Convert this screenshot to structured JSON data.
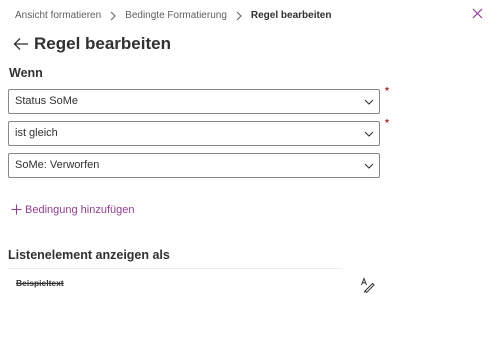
{
  "breadcrumb": {
    "items": [
      "Ansicht formatieren",
      "Bedingte Formatierung"
    ],
    "current": "Regel bearbeiten"
  },
  "header": {
    "title": "Regel bearbeiten"
  },
  "condition": {
    "section_label": "Wenn",
    "field": {
      "value": "Status SoMe",
      "required": true
    },
    "operator": {
      "value": "ist gleich",
      "required": true
    },
    "comparison": {
      "value": "SoMe: Verworfen",
      "required": false
    },
    "required_marker": "*",
    "add_label": "Bedingung hinzufügen"
  },
  "display": {
    "label": "Listenelement anzeigen als",
    "sample_text": "Beispieltext"
  },
  "colors": {
    "accent": "#8f3f8f",
    "required": "#a4262c",
    "border": "#8a8886",
    "text": "#323130"
  },
  "icons": [
    "chevron-right-icon",
    "close-icon",
    "back-arrow-icon",
    "chevron-down-icon",
    "plus-icon",
    "format-text-icon"
  ]
}
